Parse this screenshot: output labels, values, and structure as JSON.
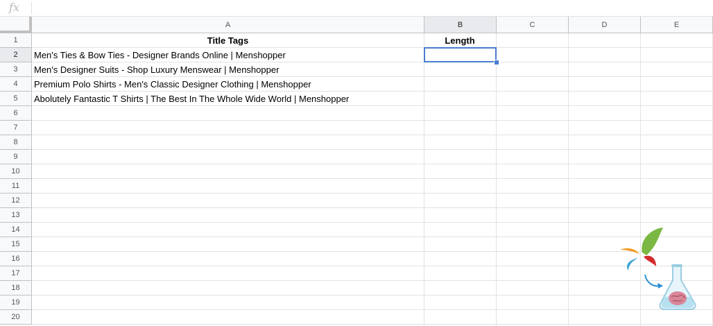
{
  "formula_bar": {
    "icon": "fx",
    "value": ""
  },
  "columns": [
    "A",
    "B",
    "C",
    "D",
    "E"
  ],
  "rows": [
    "1",
    "2",
    "3",
    "4",
    "5",
    "6",
    "7",
    "8",
    "9",
    "10",
    "11",
    "12",
    "13",
    "14",
    "15",
    "16",
    "17",
    "18",
    "19",
    "20"
  ],
  "cells": {
    "A1": "Title Tags",
    "B1": "Length",
    "A2": "Men's Ties & Bow Ties - Designer Brands Online | Menshopper",
    "A3": "Men's Designer Suits - Shop Luxury Menswear | Menshopper",
    "A4": "Premium Polo Shirts - Men's Classic Designer Clothing | Menshopper",
    "A5": "Abolutely Fantastic T Shirts | The Best In The Whole Wide World | Menshopper"
  },
  "selection": {
    "cell": "B2"
  },
  "colors": {
    "selection": "#4a7bd0",
    "header_bg": "#f8f9fa",
    "grid": "#e2e2e2"
  },
  "logo": {
    "icon": "splash-flask-brain-logo"
  }
}
